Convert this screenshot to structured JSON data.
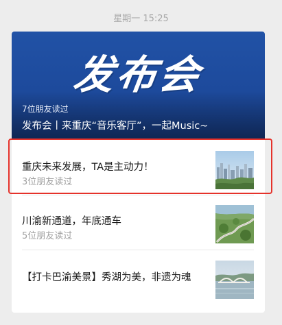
{
  "timestamp": "星期一 15:25",
  "cover": {
    "logo_text": "发布会",
    "readers": "7位朋友读过",
    "title": "发布会丨来重庆“音乐客厅”，一起Music~"
  },
  "articles": [
    {
      "title": "重庆未来发展，TA是主动力！",
      "readers": "3位朋友读过",
      "thumb": "city-skyline-thumbnail",
      "highlighted": true
    },
    {
      "title": "川渝新通道，年底通车",
      "readers": "5位朋友读过",
      "thumb": "road-aerial-thumbnail",
      "highlighted": false
    },
    {
      "title": "【打卡巴渝美景】秀湖为美，非遗为魂",
      "readers": "",
      "thumb": "lake-bridge-thumbnail",
      "highlighted": false
    }
  ],
  "colors": {
    "cover_blue": "#1d4a9c",
    "highlight_red": "#e5322b",
    "page_background": "#ededed"
  }
}
